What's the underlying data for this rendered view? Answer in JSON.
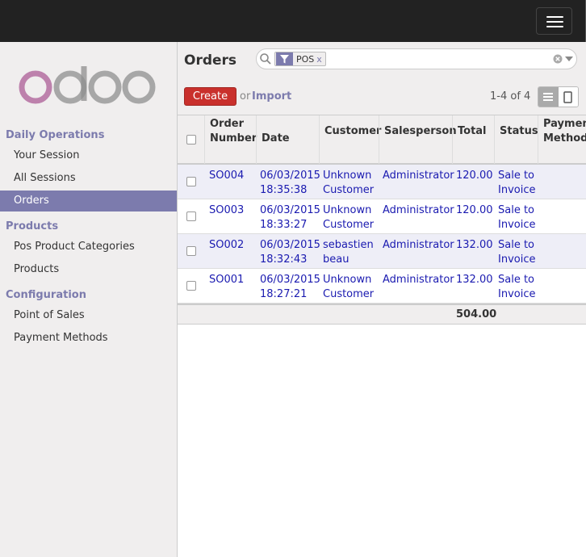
{
  "page": {
    "title": "Orders"
  },
  "sidebar": {
    "sections": [
      {
        "label": "Daily Operations",
        "items": [
          {
            "label": "Your Session"
          },
          {
            "label": "All Sessions"
          },
          {
            "label": "Orders",
            "active": true
          }
        ]
      },
      {
        "label": "Products",
        "items": [
          {
            "label": "Pos Product Categories"
          },
          {
            "label": "Products"
          }
        ]
      },
      {
        "label": "Configuration",
        "items": [
          {
            "label": "Point of Sales"
          },
          {
            "label": "Payment Methods"
          }
        ]
      }
    ]
  },
  "search": {
    "facet_icon": "filter-icon",
    "facet_label": "POS",
    "facet_remove": "x"
  },
  "toolbar": {
    "create_label": "Create",
    "or_label": "or",
    "import_label": "Import",
    "pager": "1-4 of 4"
  },
  "table": {
    "headers": [
      "Order Number",
      "Date",
      "Customer",
      "Salesperson",
      "Total",
      "Status",
      "Payment Method"
    ],
    "header_lines": [
      [
        "Order",
        "Number"
      ],
      [
        "Date"
      ],
      [
        "Customer"
      ],
      [
        "Salesperson"
      ],
      [
        "Total"
      ],
      [
        "Status"
      ],
      [
        "Payment",
        "Method"
      ]
    ],
    "rows": [
      {
        "order": "SO004",
        "date": [
          "06/03/2015",
          "18:35:38"
        ],
        "customer": [
          "Unknown",
          "Customer"
        ],
        "salesperson": "Administrator",
        "total": "120.00",
        "status": [
          "Sale to",
          "Invoice"
        ]
      },
      {
        "order": "SO003",
        "date": [
          "06/03/2015",
          "18:33:27"
        ],
        "customer": [
          "Unknown",
          "Customer"
        ],
        "salesperson": "Administrator",
        "total": "120.00",
        "status": [
          "Sale to",
          "Invoice"
        ]
      },
      {
        "order": "SO002",
        "date": [
          "06/03/2015",
          "18:32:43"
        ],
        "customer": [
          "sebastien",
          "beau"
        ],
        "salesperson": "Administrator",
        "total": "132.00",
        "status": [
          "Sale to",
          "Invoice"
        ]
      },
      {
        "order": "SO001",
        "date": [
          "06/03/2015",
          "18:27:21"
        ],
        "customer": [
          "Unknown",
          "Customer"
        ],
        "salesperson": "Administrator",
        "total": "132.00",
        "status": [
          "Sale to",
          "Invoice"
        ]
      }
    ],
    "footer_total": "504.00"
  },
  "colors": {
    "brand": "#7c7bad",
    "create": "#c9302c",
    "link": "#1a1ab0"
  }
}
